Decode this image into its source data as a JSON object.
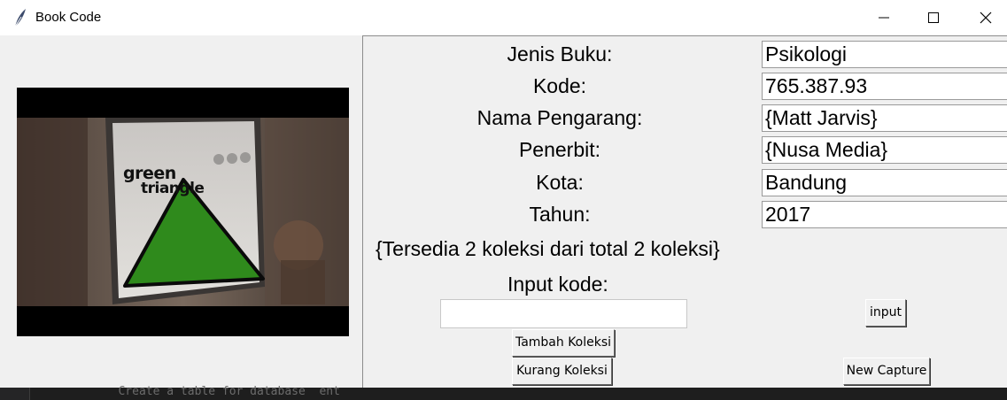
{
  "window": {
    "title": "Book Code",
    "icon": "feather-icon"
  },
  "camera": {
    "detection_labels": [
      "green",
      "triangle"
    ],
    "shape_color": "#2f8a1c"
  },
  "fields": [
    {
      "label": "Jenis Buku:",
      "value": "Psikologi"
    },
    {
      "label": "Kode:",
      "value": "765.387.93"
    },
    {
      "label": "Nama Pengarang:",
      "value": "{Matt Jarvis}"
    },
    {
      "label": "Penerbit:",
      "value": "{Nusa Media}"
    },
    {
      "label": "Kota:",
      "value": "Bandung"
    },
    {
      "label": "Tahun:",
      "value": "2017"
    }
  ],
  "status": "{Tersedia 2 koleksi dari total 2 koleksi}",
  "input_section": {
    "label": "Input kode:",
    "value": "",
    "submit_label": "input"
  },
  "buttons": {
    "tambah": "Tambah Koleksi",
    "kurang": "Kurang Koleksi",
    "new_capture": "New Capture"
  },
  "background_editor_text": "   Create a table for database  ent"
}
